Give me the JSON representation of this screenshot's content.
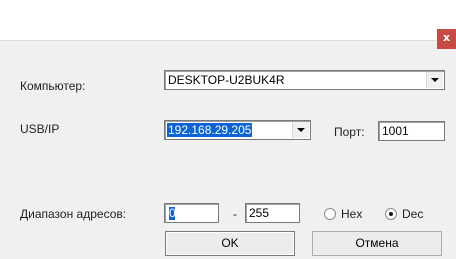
{
  "dialog": {
    "close_glyph": "x"
  },
  "computer": {
    "label": "Компьютер:",
    "value": "DESKTOP-U2BUK4R"
  },
  "usbip": {
    "label": "USB/IP",
    "value": "192.168.29.205",
    "port_label": "Порт:",
    "port_value": "1001"
  },
  "range": {
    "label": "Диапазон адресов:",
    "from": "0",
    "separator": "-",
    "to": "255",
    "options": [
      {
        "label": "Hex",
        "selected": false
      },
      {
        "label": "Dec",
        "selected": true
      }
    ]
  },
  "buttons": {
    "ok": "OK",
    "cancel": "Отмена"
  },
  "colors": {
    "close": "#c74a43",
    "selection": "#0a64d6"
  }
}
